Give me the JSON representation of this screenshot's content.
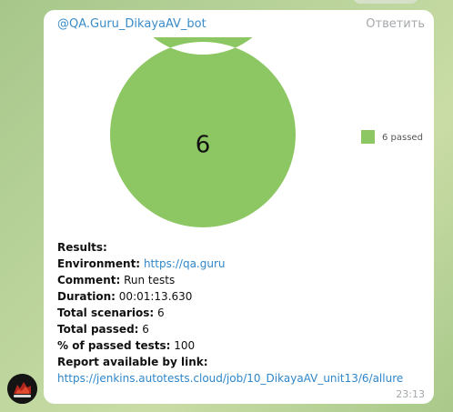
{
  "message": {
    "sender": "@QA.Guru_DikayaAV_bot",
    "reply_label": "Ответить",
    "time": "23:13"
  },
  "chart_data": {
    "type": "pie",
    "style": "donut",
    "center_label": "6",
    "categories": [
      "6 passed"
    ],
    "values": [
      6
    ],
    "colors": [
      "#8dc763"
    ],
    "legend_placement": "right"
  },
  "report": {
    "results_label": "Results:",
    "environment_label": "Environment:",
    "environment_value": "https://qa.guru",
    "comment_label": "Comment:",
    "comment_value": "Run tests",
    "duration_label": "Duration:",
    "duration_value": "00:01:13.630",
    "total_scenarios_label": "Total scenarios:",
    "total_scenarios_value": "6",
    "total_passed_label": "Total passed:",
    "total_passed_value": "6",
    "percent_passed_label": "% of passed tests:",
    "percent_passed_value": "100",
    "report_link_label": "Report available by link:",
    "report_link_value": "https://jenkins.autotests.cloud/job/10_DikayaAV_unit13/6/allure"
  },
  "colors": {
    "accent": "#3a8cc8",
    "link": "#2f86c9",
    "passed": "#8dc763",
    "background": "#b9d39a"
  }
}
